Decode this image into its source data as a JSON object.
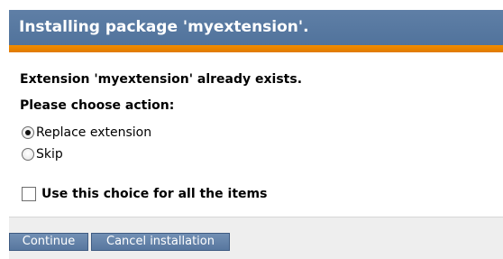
{
  "dialog": {
    "title": "Installing package 'myextension'.",
    "message": "Extension 'myextension' already exists.",
    "prompt": "Please choose action:",
    "options": [
      {
        "label": "Replace extension",
        "selected": true
      },
      {
        "label": "Skip",
        "selected": false
      }
    ],
    "apply_all": {
      "label": "Use this choice for all the items",
      "checked": false
    },
    "buttons": {
      "continue": "Continue",
      "cancel": "Cancel installation"
    }
  },
  "colors": {
    "title_bar": "#5a7aa2",
    "accent_bar": "#e88400",
    "button": "#6585ac"
  }
}
